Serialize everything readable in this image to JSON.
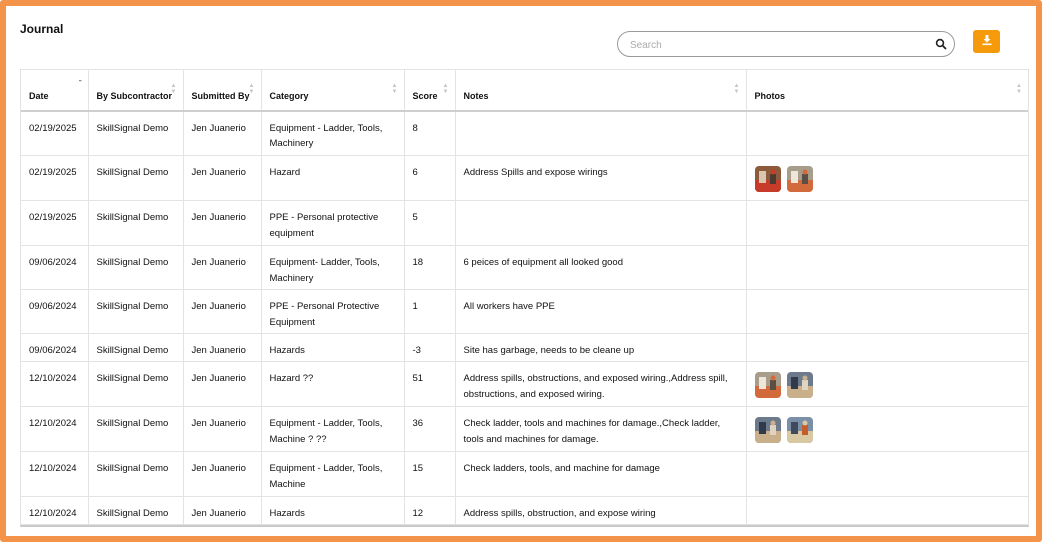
{
  "page": {
    "title": "Journal"
  },
  "search": {
    "placeholder": "Search",
    "value": ""
  },
  "columns": [
    {
      "key": "date",
      "label": "Date",
      "sort": "desc"
    },
    {
      "key": "subcontractor",
      "label": "By Subcontractor",
      "sort": "none"
    },
    {
      "key": "submitted_by",
      "label": "Submitted By",
      "sort": "none"
    },
    {
      "key": "category",
      "label": "Category",
      "sort": "none"
    },
    {
      "key": "score",
      "label": "Score",
      "sort": "none"
    },
    {
      "key": "notes",
      "label": "Notes",
      "sort": "none"
    },
    {
      "key": "photos",
      "label": "Photos",
      "sort": "none"
    }
  ],
  "rows": [
    {
      "date": "02/19/2025",
      "subcontractor": "SkillSignal Demo",
      "submitted_by": "Jen Juanerio",
      "category": "Equipment - Ladder, Tools, Machinery",
      "score": "8",
      "notes": "",
      "photo_count": 0
    },
    {
      "date": "02/19/2025",
      "subcontractor": "SkillSignal Demo",
      "submitted_by": "Jen Juanerio",
      "category": "Hazard",
      "score": "6",
      "notes": "Address Spills and expose wirings",
      "photo_count": 2
    },
    {
      "date": "02/19/2025",
      "subcontractor": "SkillSignal Demo",
      "submitted_by": "Jen Juanerio",
      "category": "PPE - Personal protective equipment",
      "score": "5",
      "notes": "",
      "photo_count": 0
    },
    {
      "date": "09/06/2024",
      "subcontractor": "SkillSignal Demo",
      "submitted_by": "Jen Juanerio",
      "category": "Equipment- Ladder, Tools, Machinery",
      "score": "18",
      "notes": "6 peices of equipment all looked good",
      "photo_count": 0
    },
    {
      "date": "09/06/2024",
      "subcontractor": "SkillSignal Demo",
      "submitted_by": "Jen Juanerio",
      "category": "PPE - Personal Protective Equipment",
      "score": "1",
      "notes": "All workers have PPE",
      "photo_count": 0
    },
    {
      "date": "09/06/2024",
      "subcontractor": "SkillSignal Demo",
      "submitted_by": "Jen Juanerio",
      "category": "Hazards",
      "score": "-3",
      "notes": "Site has garbage, needs to be cleane up",
      "photo_count": 0
    },
    {
      "date": "12/10/2024",
      "subcontractor": "SkillSignal Demo",
      "submitted_by": "Jen Juanerio",
      "category": "Hazard ??",
      "score": "51",
      "notes": "Address spills, obstructions, and exposed wiring.,Address spill, obstructions, and exposed wiring.",
      "photo_count": 2
    },
    {
      "date": "12/10/2024",
      "subcontractor": "SkillSignal Demo",
      "submitted_by": "Jen Juanerio",
      "category": "Equipment - Ladder, Tools, Machine ? ??",
      "score": "36",
      "notes": "Check ladder, tools and machines for damage.,Check ladder, tools and machines for damage.",
      "photo_count": 2
    },
    {
      "date": "12/10/2024",
      "subcontractor": "SkillSignal Demo",
      "submitted_by": "Jen Juanerio",
      "category": "Equipment - Ladder, Tools, Machine",
      "score": "15",
      "notes": "Check ladders, tools, and machine for damage",
      "photo_count": 0
    },
    {
      "date": "12/10/2024",
      "subcontractor": "SkillSignal Demo",
      "submitted_by": "Jen Juanerio",
      "category": "Hazards",
      "score": "12",
      "notes": "Address spills, obstruction, and expose wiring",
      "photo_count": 0
    }
  ],
  "icons": {
    "search": "search-icon",
    "download": "download-icon",
    "sort": "sort-icon",
    "photo": "photo-thumbnail"
  },
  "colors": {
    "frame": "#f4934a",
    "download_button": "#f59a0b",
    "border": "#e3e3e3"
  }
}
